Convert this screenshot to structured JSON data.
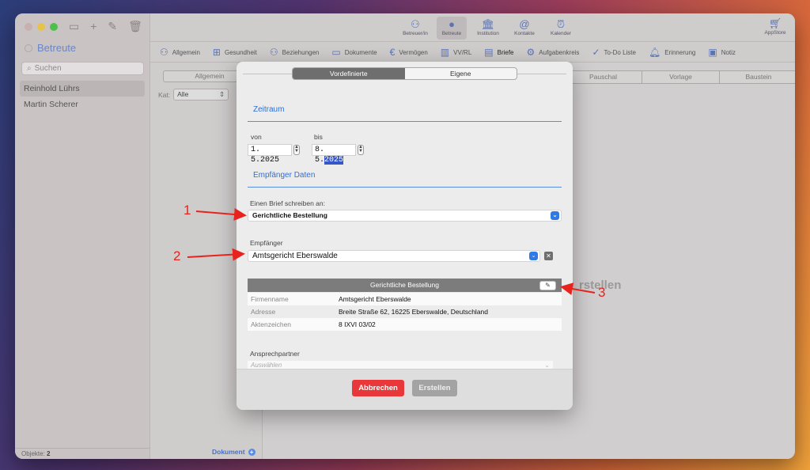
{
  "sidebar": {
    "title": "Betreute",
    "search_placeholder": "Suchen",
    "items": [
      {
        "label": "Reinhold Lührs",
        "selected": true
      },
      {
        "label": "Martin Scherer",
        "selected": false
      }
    ],
    "footer_label": "Objekte:",
    "footer_count": "2"
  },
  "toolbar": {
    "buttons": [
      {
        "label": "Betreuer/in",
        "icon": "person-outline-icon"
      },
      {
        "label": "Betreute",
        "icon": "person-icon",
        "active": true
      },
      {
        "label": "Institution",
        "icon": "building-icon"
      },
      {
        "label": "Kontakte",
        "icon": "contacts-icon"
      },
      {
        "label": "Kalender",
        "icon": "alarm-clock-icon"
      }
    ],
    "appstore_label": "AppStore"
  },
  "tabs": [
    {
      "label": "Allgemein",
      "icon": "person-icon"
    },
    {
      "label": "Gesundheit",
      "icon": "medical-case-icon"
    },
    {
      "label": "Beziehungen",
      "icon": "people-icon"
    },
    {
      "label": "Dokumente",
      "icon": "folder-icon"
    },
    {
      "label": "Vermögen",
      "icon": "euro-icon"
    },
    {
      "label": "VV/RL",
      "icon": "books-icon"
    },
    {
      "label": "Briefe",
      "icon": "document-icon",
      "active": true
    },
    {
      "label": "Aufgabenkreis",
      "icon": "people-gear-icon"
    },
    {
      "label": "To-Do Liste",
      "icon": "checkmark-circle-icon"
    },
    {
      "label": "Erinnerung",
      "icon": "bell-icon"
    },
    {
      "label": "Notiz",
      "icon": "note-icon"
    }
  ],
  "midcol": {
    "segment_label": "Allgemein",
    "kat_label": "Kat:",
    "kat_value": "Alle",
    "document_link": "Dokument"
  },
  "main": {
    "segments": [
      "Pauschal",
      "Vorlage",
      "Baustein"
    ],
    "background_text": "rstellen"
  },
  "modal": {
    "segments": [
      {
        "label": "Vordefinierte",
        "active": true
      },
      {
        "label": "Eigene",
        "active": false
      }
    ],
    "zeitraum_title": "Zeitraum",
    "von_label": "von",
    "von_value": "1. 5.2025",
    "bis_label": "bis",
    "bis_value_prefix": "8. 5.",
    "bis_value_selected": "2025",
    "empfaenger_title": "Empfänger Daten",
    "brief_label": "Einen Brief schreiben an:",
    "brief_value": "Gerichtliche Bestellung",
    "empfaenger_label": "Empfänger",
    "empfaenger_value": "Amtsgericht Eberswalde",
    "card_title": "Gerichtliche Bestellung",
    "card_rows": [
      {
        "key": "Firmenname",
        "value": "Amtsgericht Eberswalde"
      },
      {
        "key": "Adresse",
        "value": "Breite Straße 62, 16225 Eberswalde, Deutschland"
      },
      {
        "key": "Aktenzeichen",
        "value": "8 IXVI 03/02"
      }
    ],
    "ansprechpartner_label": "Ansprechpartner",
    "ansprechpartner_placeholder": "Auswählen",
    "cancel_label": "Abbrechen",
    "create_label": "Erstellen"
  },
  "annotations": [
    "1",
    "2",
    "3"
  ],
  "colors": {
    "accent": "#2f7ae6",
    "cancel": "#e9383a",
    "annotation": "#e8221d"
  }
}
